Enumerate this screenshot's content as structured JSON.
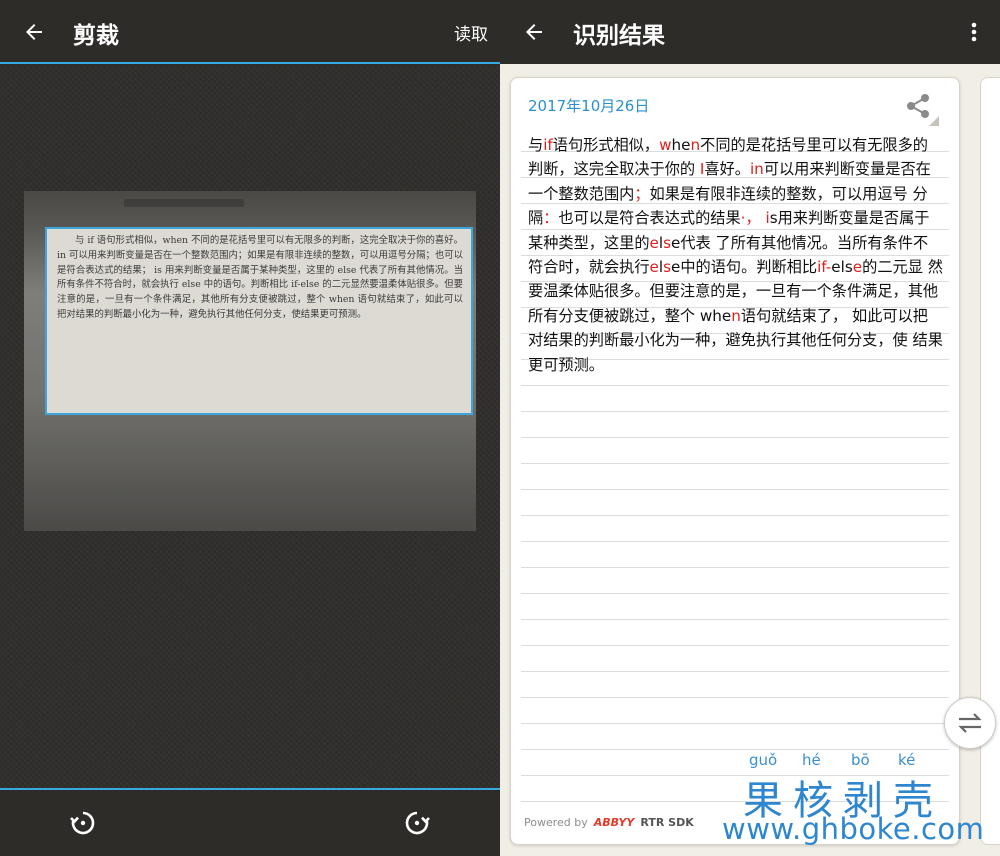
{
  "crop_screen": {
    "title": "剪裁",
    "read_label": "读取",
    "icons": {
      "back": "back-arrow-icon",
      "rotate_left": "rotate-left-icon",
      "rotate_right": "rotate-right-icon"
    },
    "cropped_text": "与 if 语句形式相似，when 不同的是花括号里可以有无限多的判断，这完全取决于你的喜好。in 可以用来判断变量是否在一个整数范围内；如果是有限非连续的整数，可以用逗号分隔；也可以是符合表达式的结果； is 用来判断变量是否属于某种类型，这里的 else 代表了所有其他情况。当所有条件不符合时，就会执行 else 中的语句。判断相比 if-else 的二元显然要温柔体贴很多。但要注意的是，一旦有一个条件满足，其他所有分支便被跳过，整个 when 语句就结束了，如此可以把对结果的判断最小化为一种，避免执行其他任何分支，使结果更可预测。",
    "accent_color": "#37a9e1"
  },
  "result_screen": {
    "title": "识别结果",
    "date": "2017年10月26日",
    "icons": {
      "back": "back-arrow-icon",
      "more": "more-vert-icon",
      "share": "share-icon",
      "swap": "swap-icon"
    },
    "segments": [
      {
        "t": "与",
        "h": false
      },
      {
        "t": "if",
        "h": true
      },
      {
        "t": "语句形式相似，",
        "h": false
      },
      {
        "t": "w",
        "h": true
      },
      {
        "t": "he",
        "h": false
      },
      {
        "t": "n",
        "h": true
      },
      {
        "t": "不同的是花括号里可以有无限多的判断，这完全取决于你的 ",
        "h": false
      },
      {
        "t": "I",
        "h": true
      },
      {
        "t": "喜好。",
        "h": false
      },
      {
        "t": "in",
        "h": true
      },
      {
        "t": "可以用来判断变量是否在一个整数范围内",
        "h": false
      },
      {
        "t": "；",
        "h": true
      },
      {
        "t": "如果是有限非连续的整数，可以用逗号 分隔",
        "h": false
      },
      {
        "t": "：",
        "h": true
      },
      {
        "t": "也可以是符合表达式的结果",
        "h": false
      },
      {
        "t": "·，",
        "h": true
      },
      {
        "t": " ",
        "h": false
      },
      {
        "t": "i",
        "h": true
      },
      {
        "t": "s用来判断变量是否属于某种类型，这里的",
        "h": false
      },
      {
        "t": "e",
        "h": true
      },
      {
        "t": "l",
        "h": false
      },
      {
        "t": "s",
        "h": true
      },
      {
        "t": "e代表 了所有其他情况。当所有条件不符合时，就会执行",
        "h": false
      },
      {
        "t": "e",
        "h": true
      },
      {
        "t": "l",
        "h": false
      },
      {
        "t": "s",
        "h": true
      },
      {
        "t": "e中的语句。判断相比",
        "h": false
      },
      {
        "t": "if-",
        "h": true
      },
      {
        "t": "els",
        "h": false
      },
      {
        "t": "e",
        "h": true
      },
      {
        "t": "的二元显 然要温柔体贴很多。但要注意的是，一旦有一个条件满足，其他所有分支便被跳过，整个 whe",
        "h": false
      },
      {
        "t": "n",
        "h": true
      },
      {
        "t": "语句就结束了， 如此可以把对结果的判断最小化为一种，避免执行其他任何分支，使 结果更可预测。",
        "h": false
      }
    ],
    "highlight_color": "#e0201b",
    "powered_by": "Powered by",
    "brand": "ABBYY",
    "sdk": "RTR SDK"
  },
  "watermark": {
    "pinyin": [
      "guǒ",
      "hé",
      "bō",
      "ké"
    ],
    "hanzi": "果核剥壳",
    "url": "www.ghboke.com",
    "color": "#2e86cf"
  }
}
